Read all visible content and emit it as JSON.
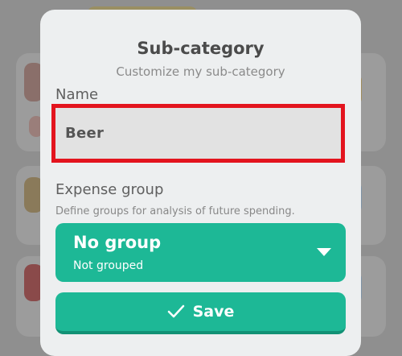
{
  "dialog": {
    "title": "Sub-category",
    "subtitle": "Customize my sub-category"
  },
  "name_field": {
    "label": "Name",
    "value": "Beer"
  },
  "expense_group": {
    "label": "Expense group",
    "hint": "Define groups for analysis of future spending.",
    "selected_value": "No group",
    "selected_description": "Not grouped",
    "icon": "chevron-down-icon"
  },
  "save_button": {
    "label": "Save",
    "icon": "check-icon"
  },
  "colors": {
    "accent": "#1db896",
    "highlight_border": "#e3141e",
    "dialog_background": "#edeff0"
  }
}
